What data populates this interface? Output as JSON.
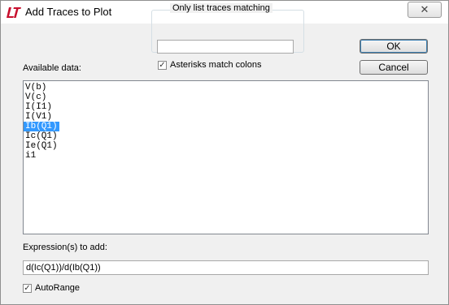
{
  "window": {
    "title": "Add Traces to Plot",
    "close_glyph": "✕"
  },
  "filter": {
    "group_label": "Only list traces matching",
    "value": "",
    "asterisks_label": "Asterisks match colons",
    "asterisks_checked": true
  },
  "buttons": {
    "ok": "OK",
    "cancel": "Cancel"
  },
  "available": {
    "label": "Available data:",
    "items": [
      "V(b)",
      "V(c)",
      "I(I1)",
      "I(V1)",
      "Ib(Q1)",
      "Ic(Q1)",
      "Ie(Q1)",
      "i1"
    ],
    "selected_index": 4
  },
  "expression": {
    "label": "Expression(s) to add:",
    "value": "d(Ic(Q1))/d(Ib(Q1))"
  },
  "autorange": {
    "label": "AutoRange",
    "checked": true
  },
  "colors": {
    "selection": "#3399ff",
    "logo": "#c8102e"
  }
}
